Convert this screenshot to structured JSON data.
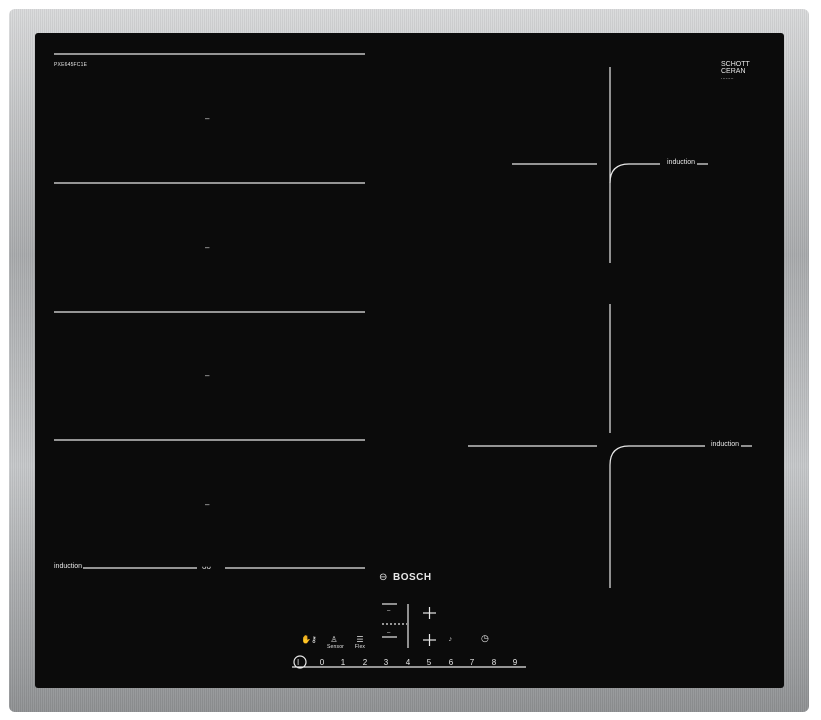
{
  "product": {
    "model_label": "PXE645FC1E",
    "glass_brand_line1": "SCHOTT",
    "glass_brand_line2": "CERAN",
    "glass_brand_sub": "........",
    "brand": "BOSCH"
  },
  "zones": {
    "left_flex_label": "induction",
    "right_top_label": "induction",
    "right_bottom_label": "induction",
    "zone_markers": [
      "–",
      "–",
      "–",
      "–"
    ]
  },
  "controls": {
    "minus_top": "–",
    "minus_bottom": "–",
    "power": "I",
    "levels": [
      "0",
      "1",
      "2",
      "3",
      "4",
      "5",
      "6",
      "7",
      "8",
      "9"
    ],
    "sublabels": [
      "Sensor",
      "Flex"
    ],
    "icons": [
      "lock-icon",
      "sensor-icon",
      "flex-icon",
      "plus-icon",
      "power-boost-icon",
      "timer-icon",
      "power-icon"
    ]
  },
  "colors": {
    "glass": "#0b0b0b",
    "line": "#e8e8e8",
    "frame": "#b8babc"
  }
}
